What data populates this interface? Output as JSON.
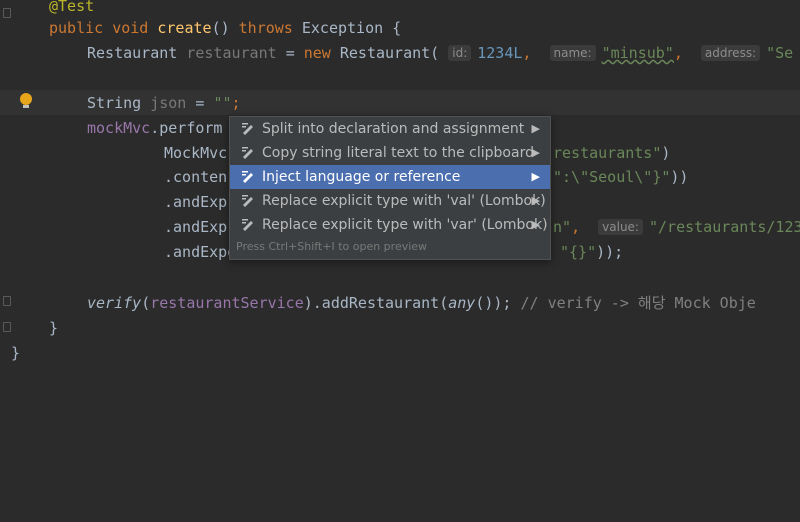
{
  "code": {
    "annotation": "@Test",
    "l2": {
      "kw1": "public",
      "kw2": "void",
      "fn": "create",
      "paren": "()",
      "kw3": "throws",
      "rest": "Exception {"
    },
    "l3": {
      "type": "Restaurant",
      "var": "restaurant",
      "eq": "=",
      "kw": "new",
      "cls": "Restaurant(",
      "hint_id": "id:",
      "id_val": "1234L",
      "comma1": ",",
      "hint_name": "name:",
      "name_val": "\"minsub\"",
      "comma2": ",",
      "hint_address": "address:",
      "addr_val": "\"Se"
    },
    "l5": {
      "type": "String",
      "var": "json",
      "eq": "=",
      "str": "\"\"",
      "semi": ";"
    },
    "l6": {
      "text": "mockMvc",
      "rest": ".perform"
    },
    "l7": {
      "text": "MockMvc",
      "str": "restaurants\"",
      "close": ")"
    },
    "l8": {
      "text": ".conten",
      "str": "\":\\\"Seoul\\\"}\"",
      "close": "))"
    },
    "l9": {
      "text": ".andExp"
    },
    "l10": {
      "text": ".andExp",
      "str": "n\"",
      "comma": ",",
      "hint_value": "value:",
      "val": "\"/restaurants/123"
    },
    "l11": {
      "text": ".andExpe",
      "str": "\"{}\"",
      "close": "));"
    },
    "l13": {
      "fn": "verify",
      "arg": "restaurantService",
      "call": ").addRestaurant(",
      "any": "any",
      "rest": "());",
      "comment": "// verify -> 해당 Mock Obje"
    },
    "l14": "}",
    "l15": "}"
  },
  "menu": {
    "items": [
      {
        "label": "Split into declaration and assignment"
      },
      {
        "label": "Copy string literal text to the clipboard"
      },
      {
        "label": "Inject language or reference"
      },
      {
        "label": "Replace explicit type with 'val' (Lombok)"
      },
      {
        "label": "Replace explicit type with 'var' (Lombok)"
      }
    ],
    "footer": "Press Ctrl+Shift+I to open preview",
    "selected_index": 2
  },
  "colors": {
    "selection": "#4b6eaf",
    "keyword": "#cc7832",
    "string": "#6a8759",
    "number": "#6897bb",
    "function": "#ffc66d"
  },
  "icons": {
    "menu_item": "intention-pencil-icon",
    "gutter": "lightbulb-icon"
  }
}
